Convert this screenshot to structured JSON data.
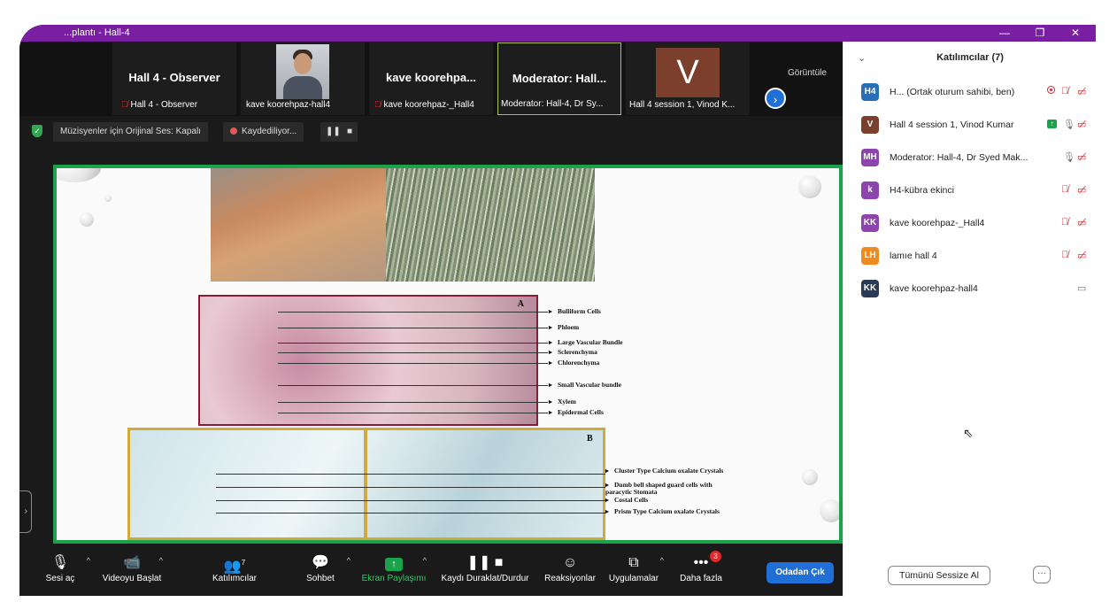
{
  "window": {
    "title": "...plantı - Hall-4",
    "minimize": "—",
    "restore": "❐",
    "close": "✕"
  },
  "tiles": [
    {
      "big": "Hall 4 - Observer",
      "caption": "Hall 4 - Observer",
      "muted": true
    },
    {
      "big": "",
      "caption": "kave koorehpaz-hall4",
      "muted": false,
      "photo": true
    },
    {
      "big": "kave  koorehpa...",
      "caption": "kave koorehpaz-_Hall4",
      "muted": true
    },
    {
      "big": "Moderator:  Hall...",
      "caption": "Moderator: Hall-4, Dr Sy...",
      "muted": false,
      "active": true
    },
    {
      "big": "V",
      "caption": "Hall 4 session 1, Vinod K...",
      "muted": false,
      "avatar": true
    }
  ],
  "tiles_view_label": "Görüntüle",
  "next_arrow": "›",
  "status": {
    "shield": "✓",
    "original_sound": "Müzisyenler için Orijinal Ses: Kapalı",
    "recording": "Kaydediliyor...",
    "pause": "❚❚",
    "stop": "■"
  },
  "slide": {
    "label_a": "A",
    "label_b": "B",
    "legend_a": [
      "Bulliform Cells",
      "Phloem",
      "Large Vascular Bundle",
      "Sclerenchyma",
      "Chlorenchyma",
      "Small Vascular bundle",
      "Xylem",
      "Epidermal Cells"
    ],
    "legend_b": [
      "Cluster Type Calcium oxalate Crystals",
      "Dumb bell shaped guard cells with paracytic Stomata",
      "Costal Cells",
      "Prism Type Calcium oxalate Crystals"
    ]
  },
  "toolbar": {
    "audio": {
      "label": "Sesi aç",
      "icon": "🎙"
    },
    "video": {
      "label": "Videoyu Başlat",
      "icon": "📹"
    },
    "participants": {
      "label": "Katılımcılar",
      "count": "7",
      "icon": "👥"
    },
    "chat": {
      "label": "Sohbet",
      "icon": "💬"
    },
    "share": {
      "label": "Ekran Paylaşımı",
      "icon": "↑"
    },
    "record": {
      "label": "Kaydı Duraklat/Durdur",
      "icon": "❚❚ ■"
    },
    "reactions": {
      "label": "Reaksiyonlar",
      "icon": "☺"
    },
    "apps": {
      "label": "Uygulamalar",
      "icon": "⧉"
    },
    "more": {
      "label": "Daha fazla",
      "icon": "•••",
      "badge": "3"
    },
    "leave": "Odadan Çık",
    "caret": "^"
  },
  "panel": {
    "title": "Katılımcılar (7)",
    "collapse": "⌄",
    "participants": [
      {
        "initials": "H4",
        "color": "#2a6fb5",
        "name": "H... (Ortak oturum sahibi, ben)",
        "rec": true,
        "mic_muted": true,
        "cam_off": true
      },
      {
        "initials": "V",
        "color": "#7b3f2c",
        "name": "Hall 4 session 1, Vinod Kumar",
        "share": true,
        "mic_muted": false,
        "cam_off": true
      },
      {
        "initials": "MH",
        "color": "#8e44ad",
        "name": "Moderator: Hall-4, Dr Syed Mak...",
        "mic_muted": false,
        "cam_off": true
      },
      {
        "initials": "k",
        "color": "#8e44ad",
        "name": "H4-kübra ekinci",
        "mic_muted": true,
        "cam_off": true
      },
      {
        "initials": "KK",
        "color": "#8e44ad",
        "name": "kave koorehpaz-_Hall4",
        "mic_muted": true,
        "cam_off": true
      },
      {
        "initials": "LH",
        "color": "#f08a1d",
        "name": "lamıe hall 4",
        "mic_muted": true,
        "cam_off": true
      },
      {
        "initials": "KK",
        "color": "#2b3a55",
        "name": "kave koorehpaz-hall4",
        "mic_muted": null,
        "cam_off": false
      }
    ],
    "mute_all": "Tümünü Sessize Al",
    "more": "···"
  }
}
